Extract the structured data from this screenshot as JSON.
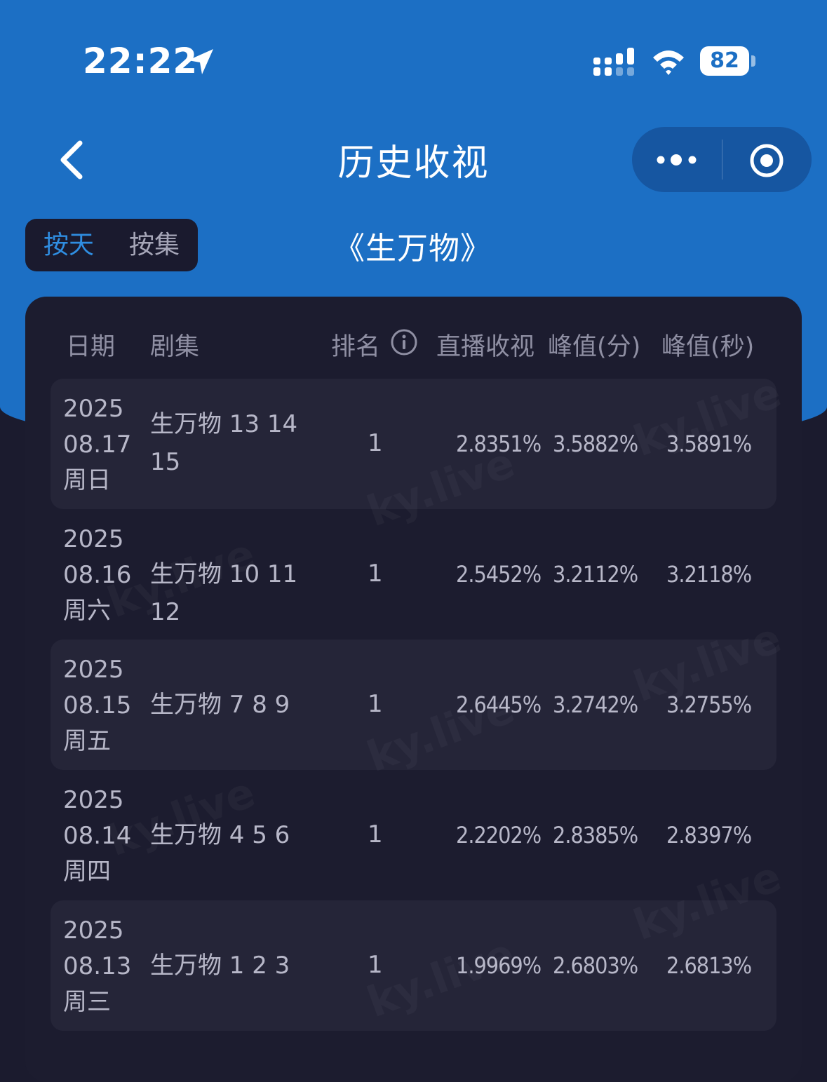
{
  "status_bar": {
    "time": "22:22",
    "battery": "82"
  },
  "nav": {
    "title": "历史收视"
  },
  "tabs": {
    "by_day": "按天",
    "by_episode": "按集"
  },
  "show_title": "《生万物》",
  "table": {
    "headers": {
      "date": "日期",
      "episode": "剧集",
      "rank": "排名",
      "live": "直播收视",
      "peak_min": "峰值(分)",
      "peak_sec": "峰值(秒)"
    },
    "rows": [
      {
        "year": "2025",
        "date": "08.17",
        "weekday": "周日",
        "episode": "生万物 13 14 15",
        "rank": "1",
        "live": "2.8351%",
        "peak_min": "3.5882%",
        "peak_sec": "3.5891%"
      },
      {
        "year": "2025",
        "date": "08.16",
        "weekday": "周六",
        "episode": "生万物 10 11 12",
        "rank": "1",
        "live": "2.5452%",
        "peak_min": "3.2112%",
        "peak_sec": "3.2118%"
      },
      {
        "year": "2025",
        "date": "08.15",
        "weekday": "周五",
        "episode": "生万物 7 8 9",
        "rank": "1",
        "live": "2.6445%",
        "peak_min": "3.2742%",
        "peak_sec": "3.2755%"
      },
      {
        "year": "2025",
        "date": "08.14",
        "weekday": "周四",
        "episode": "生万物 4 5 6",
        "rank": "1",
        "live": "2.2202%",
        "peak_min": "2.8385%",
        "peak_sec": "2.8397%"
      },
      {
        "year": "2025",
        "date": "08.13",
        "weekday": "周三",
        "episode": "生万物 1 2 3",
        "rank": "1",
        "live": "1.9969%",
        "peak_min": "2.6803%",
        "peak_sec": "2.6813%"
      }
    ]
  },
  "watermark": "ky.live",
  "colors": {
    "header_blue": "#1c6fc4",
    "accent": "#2f8de0",
    "background": "#1b1b2e"
  }
}
